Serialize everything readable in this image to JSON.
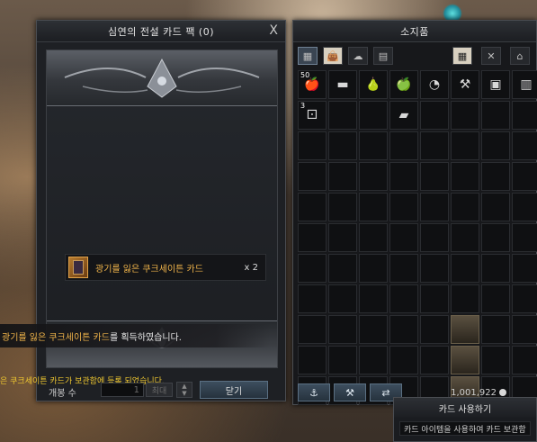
{
  "card_pack": {
    "title": "심연의 전설 카드 팩 (0)",
    "close_glyph": "X",
    "reward": {
      "name": "광기를 잃은 쿠크세이튼 카드",
      "count": "x 2"
    },
    "notification": {
      "highlight": "광기를 잃은 쿠크세이튼 카드",
      "rest": "를 획득하였습니다."
    },
    "notification2": "은 쿠크세이튼 카드가 보관함에 등록 되었습니다.",
    "open_count_label": "개봉 수",
    "open_count_value": "1",
    "max_label": "최대",
    "close_button": "닫기"
  },
  "inventory": {
    "title": "소지품",
    "silver": "1,001,922",
    "slots": [
      {
        "icon": "🍎",
        "qty": "50"
      },
      {
        "icon": "▬",
        "qty": ""
      },
      {
        "icon": "🍐",
        "qty": ""
      },
      {
        "icon": "🍏",
        "qty": ""
      },
      {
        "icon": "◔",
        "qty": ""
      },
      {
        "icon": "⚒",
        "qty": ""
      },
      {
        "icon": "▣",
        "qty": ""
      },
      {
        "icon": "▥",
        "qty": ""
      },
      {
        "icon": "⚀",
        "qty": "3"
      },
      {
        "icon": "",
        "qty": ""
      },
      {
        "icon": "",
        "qty": ""
      },
      {
        "icon": "▰",
        "qty": ""
      }
    ]
  },
  "card_popup": {
    "title": "카드 사용하기",
    "body": "카드 아이템을 사용하여 카드 보관함"
  }
}
